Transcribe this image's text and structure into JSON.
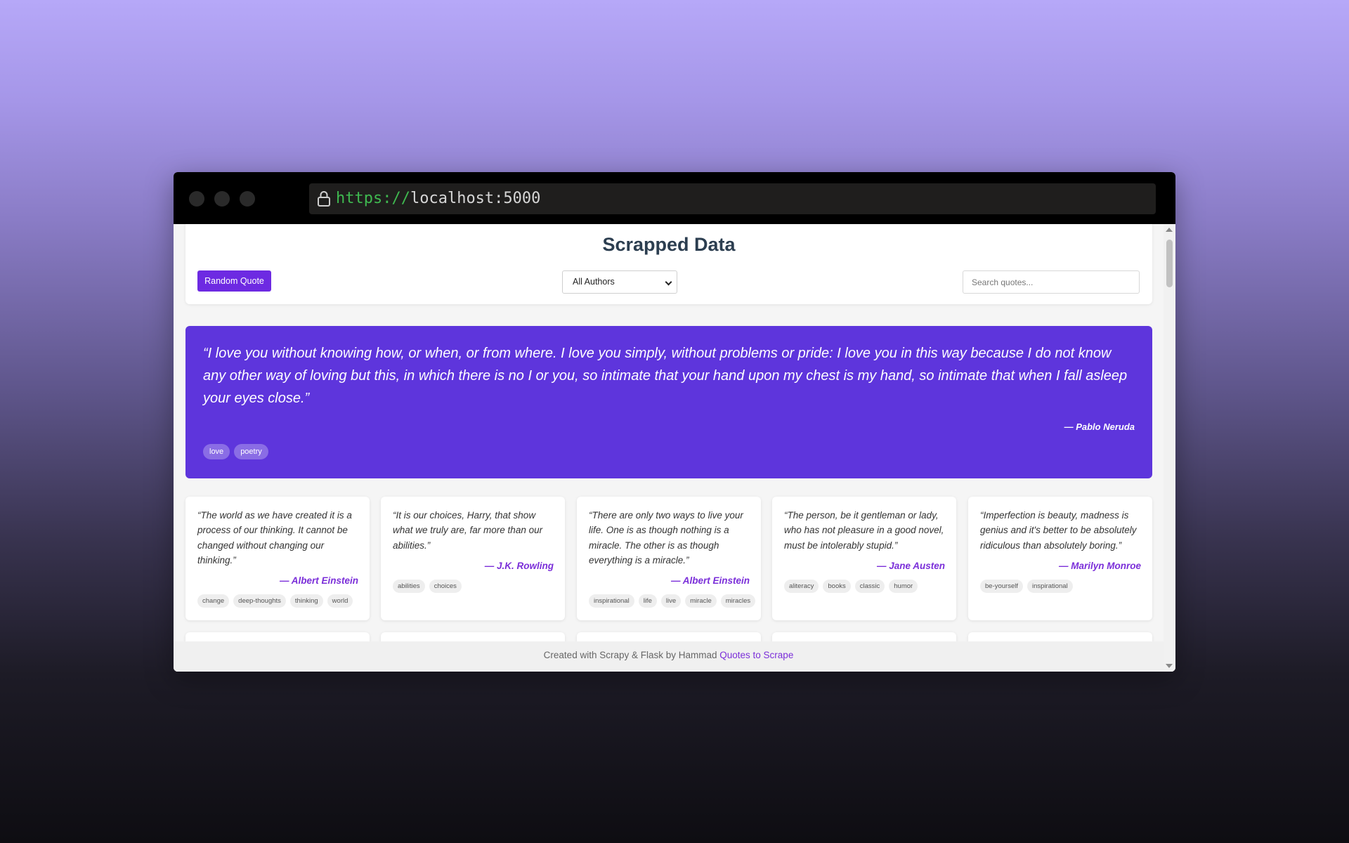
{
  "browser": {
    "url_scheme": "https://",
    "url_host": "localhost:5000"
  },
  "header": {
    "title": "Scrapped Data",
    "random_button": "Random Quote",
    "author_select_value": "All Authors",
    "search_placeholder": "Search quotes..."
  },
  "featured": {
    "text": "“I love you without knowing how, or when, or from where. I love you simply, without problems or pride: I love you in this way because I do not know any other way of loving but this, in which there is no I or you, so intimate that your hand upon my chest is my hand, so intimate that when I fall asleep your eyes close.”",
    "author": "— Pablo Neruda",
    "tags": [
      "love",
      "poetry"
    ]
  },
  "cards": [
    {
      "text": "“The world as we have created it is a process of our thinking. It cannot be changed without changing our thinking.”",
      "author": "— Albert Einstein",
      "tags": [
        "change",
        "deep-thoughts",
        "thinking",
        "world"
      ]
    },
    {
      "text": "“It is our choices, Harry, that show what we truly are, far more than our abilities.”",
      "author": "— J.K. Rowling",
      "tags": [
        "abilities",
        "choices"
      ]
    },
    {
      "text": "“There are only two ways to live your life. One is as though nothing is a miracle. The other is as though everything is a miracle.”",
      "author": "— Albert Einstein",
      "tags": [
        "inspirational",
        "life",
        "live",
        "miracle",
        "miracles"
      ]
    },
    {
      "text": "“The person, be it gentleman or lady, who has not pleasure in a good novel, must be intolerably stupid.”",
      "author": "— Jane Austen",
      "tags": [
        "aliteracy",
        "books",
        "classic",
        "humor"
      ]
    },
    {
      "text": "“Imperfection is beauty, madness is genius and it's better to be absolutely ridiculous than absolutely boring.”",
      "author": "— Marilyn Monroe",
      "tags": [
        "be-yourself",
        "inspirational"
      ]
    }
  ],
  "footer": {
    "text": "Created with Scrapy & Flask by Hammad ",
    "link": "Quotes to Scrape"
  }
}
